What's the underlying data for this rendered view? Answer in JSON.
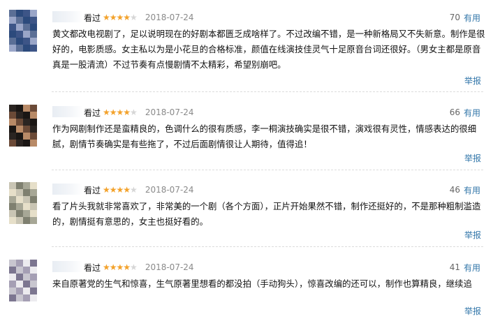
{
  "reviews": [
    {
      "seen": "看过",
      "stars": 4,
      "date": "2018-07-24",
      "votes": "70",
      "useful": "有用",
      "content": "黄文都改电视剧了，足以说明现在的好剧本都匮乏成啥样了。不过改编不错，是一种新格局又不失新意。制作是很好的，电影质感。女主私以为是小花旦的合格标准，颜值在线演技佳灵气十足原音台词还很好。（男女主都是原音真是一股清流）不过节奏有点慢剧情不太精彩，希望别崩吧。",
      "report": "举报",
      "avatar_colors": [
        "#5b6f96",
        "#9aa6c8",
        "#3d5587",
        "#2c4a7c"
      ]
    },
    {
      "seen": "看过",
      "stars": 4,
      "date": "2018-07-24",
      "votes": "66",
      "useful": "有用",
      "content": "作为网剧制作还是蛮精良的，色调什么的很有质感，李一桐演技确实是很不错，演戏很有灵性，情感表达的很细腻，剧情节奏确实是有些拖了，不过后面剧情很让人期待，值得追！",
      "report": "举报",
      "avatar_colors": [
        "#2a2421",
        "#6b4a37",
        "#b88a67",
        "#1a1614"
      ]
    },
    {
      "seen": "看过",
      "stars": 4,
      "date": "2018-07-24",
      "votes": "46",
      "useful": "有用",
      "content": "看了片头我就非常喜欢了，非常美的一个剧（各个方面），正片开始果然不错，制作还挺好的，不是那种粗制滥造的，剧情挺有意思的，女主也挺好看的。",
      "report": "举报",
      "avatar_colors": [
        "#c9c5b4",
        "#e6dfc9",
        "#a7a796",
        "#7f8070"
      ]
    },
    {
      "seen": "看过",
      "stars": 4,
      "date": "2018-07-24",
      "votes": "41",
      "useful": "有用",
      "content": "来自原著党的生气和惊喜，生气原著里想看的都没拍（手动狗头），惊喜改编的还可以，制作也算精良，继续追",
      "report": "举报",
      "avatar_colors": [
        "#c8c6cf",
        "#7c7690",
        "#ecebef",
        "#a59fb4"
      ]
    }
  ]
}
